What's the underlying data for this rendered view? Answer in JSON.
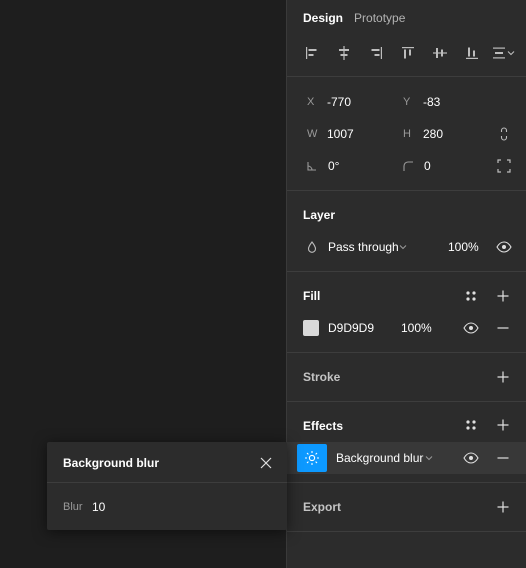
{
  "tabs": [
    {
      "label": "Design",
      "active": true
    },
    {
      "label": "Prototype",
      "active": false
    }
  ],
  "alignment_icons": [
    "align-left-icon",
    "align-horizontal-center-icon",
    "align-right-icon",
    "align-top-icon",
    "align-vertical-center-icon",
    "align-bottom-icon",
    "distribute-dropdown-icon"
  ],
  "position": {
    "x_label": "X",
    "x_value": "-770",
    "y_label": "Y",
    "y_value": "-83"
  },
  "size": {
    "w_label": "W",
    "w_value": "1007",
    "h_label": "H",
    "h_value": "280"
  },
  "rotation": {
    "value": "0°"
  },
  "corner_radius": {
    "value": "0"
  },
  "layer": {
    "title": "Layer",
    "blend_mode": "Pass through",
    "opacity": "100%"
  },
  "fill": {
    "title": "Fill",
    "hex": "D9D9D9",
    "opacity": "100%",
    "swatch_color": "#d9d9d9"
  },
  "stroke": {
    "title": "Stroke"
  },
  "effects": {
    "title": "Effects",
    "effect_type": "Background blur",
    "accent_color": "#0d99ff"
  },
  "export": {
    "title": "Export"
  },
  "popover": {
    "title": "Background blur",
    "blur_label": "Blur",
    "blur_value": "10"
  }
}
